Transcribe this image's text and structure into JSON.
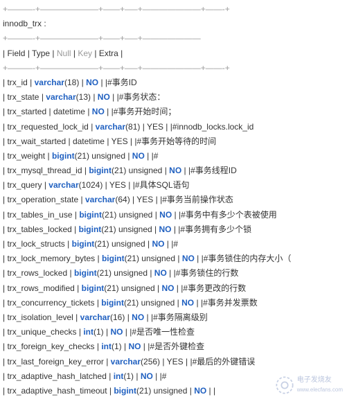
{
  "table_name": "innodb_trx :",
  "divider_full": "+———-+———————+——+—–+———————+——-+",
  "divider_head": "+———-+———————+——+—–+———————",
  "header": {
    "c1": "Field",
    "c2": "Type",
    "c3": "Null",
    "c4": "Key",
    "c5": "Extra"
  },
  "rows": [
    {
      "field": "trx_id",
      "type_pre": "",
      "type_kw": "varchar",
      "type_args": "(18)",
      "null_kw": "NO",
      "comment": "#事务ID"
    },
    {
      "field": "trx_state",
      "type_pre": "",
      "type_kw": "varchar",
      "type_args": "(13)",
      "null_kw": "NO",
      "comment": "#事务状态："
    },
    {
      "field": "trx_started",
      "type_pre": "datetime",
      "type_kw": "",
      "type_args": "",
      "null_kw": "NO",
      "comment": "#事务开始时间；"
    },
    {
      "field": "trx_requested_lock_id",
      "type_pre": "",
      "type_kw": "varchar",
      "type_args": "(81)",
      "null_kw": "",
      "null_plain": "YES",
      "comment": "#innodb_locks.lock_id"
    },
    {
      "field": "trx_wait_started",
      "type_pre": "datetime",
      "type_kw": "",
      "type_args": "",
      "null_kw": "",
      "null_plain": "YES",
      "comment": "#事务开始等待的时间"
    },
    {
      "field": "trx_weight",
      "type_pre": "",
      "type_kw": "bigint",
      "type_args": "(21) unsigned",
      "null_kw": "NO",
      "comment": "#"
    },
    {
      "field": "trx_mysql_thread_id",
      "type_pre": "",
      "type_kw": "bigint",
      "type_args": "(21) unsigned",
      "null_kw": "NO",
      "comment": "#事务线程ID"
    },
    {
      "field": "trx_query",
      "type_pre": "",
      "type_kw": "varchar",
      "type_args": "(1024)",
      "null_kw": "",
      "null_plain": "YES",
      "comment": "#具体SQL语句"
    },
    {
      "field": "trx_operation_state",
      "type_pre": "",
      "type_kw": "varchar",
      "type_args": "(64)",
      "null_kw": "",
      "null_plain": "YES",
      "comment": "#事务当前操作状态"
    },
    {
      "field": "trx_tables_in_use",
      "type_pre": "",
      "type_kw": "bigint",
      "type_args": "(21) unsigned",
      "null_kw": "NO",
      "comment": "#事务中有多少个表被使用"
    },
    {
      "field": "trx_tables_locked",
      "type_pre": "",
      "type_kw": "bigint",
      "type_args": "(21) unsigned",
      "null_kw": "NO",
      "comment": "#事务拥有多少个锁"
    },
    {
      "field": "trx_lock_structs",
      "type_pre": "",
      "type_kw": "bigint",
      "type_args": "(21) unsigned",
      "null_kw": "NO",
      "comment": "#"
    },
    {
      "field": "trx_lock_memory_bytes",
      "type_pre": "",
      "type_kw": "bigint",
      "type_args": "(21) unsigned",
      "null_kw": "NO",
      "comment": "#事务锁住的内存大小（"
    },
    {
      "field": "trx_rows_locked",
      "type_pre": "",
      "type_kw": "bigint",
      "type_args": "(21) unsigned",
      "null_kw": "NO",
      "comment": "#事务锁住的行数"
    },
    {
      "field": "trx_rows_modified",
      "type_pre": "",
      "type_kw": "bigint",
      "type_args": "(21) unsigned",
      "null_kw": "NO",
      "comment": "#事务更改的行数"
    },
    {
      "field": "trx_concurrency_tickets",
      "type_pre": "",
      "type_kw": "bigint",
      "type_args": "(21) unsigned",
      "null_kw": "NO",
      "comment": "#事务并发票数"
    },
    {
      "field": "trx_isolation_level",
      "type_pre": "",
      "type_kw": "varchar",
      "type_args": "(16)",
      "null_kw": "NO",
      "comment": "#事务隔离级别"
    },
    {
      "field": "trx_unique_checks",
      "type_pre": "",
      "type_kw": "int",
      "type_args": "(1)",
      "null_kw": "NO",
      "comment": "#是否唯一性检查"
    },
    {
      "field": "trx_foreign_key_checks",
      "type_pre": "",
      "type_kw": "int",
      "type_args": "(1)",
      "null_kw": "NO",
      "comment": "#是否外键检查"
    },
    {
      "field": "trx_last_foreign_key_error",
      "type_pre": "",
      "type_kw": "varchar",
      "type_args": "(256)",
      "null_kw": "",
      "null_plain": "YES",
      "comment": "#最后的外键错误"
    },
    {
      "field": "trx_adaptive_hash_latched",
      "type_pre": "",
      "type_kw": "int",
      "type_args": "(1)",
      "null_kw": "NO",
      "comment": "#"
    },
    {
      "field": "trx_adaptive_hash_timeout",
      "type_pre": "",
      "type_kw": "bigint",
      "type_args": "(21) unsigned",
      "null_kw": "NO",
      "comment": ""
    }
  ],
  "watermark": "电子发烧友",
  "watermark_sub": "www.elecfans.com"
}
